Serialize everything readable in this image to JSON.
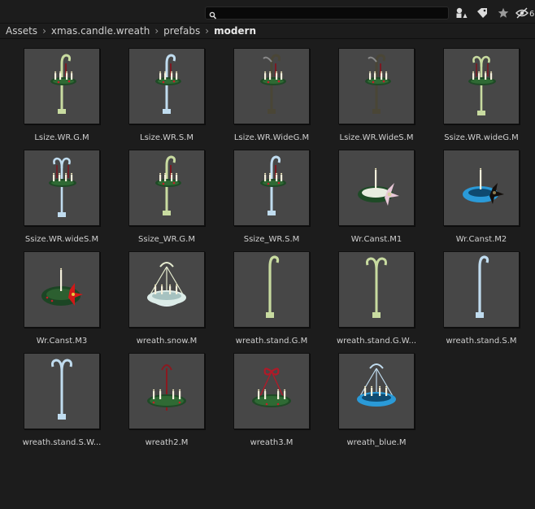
{
  "search": {
    "placeholder": "",
    "value": ""
  },
  "toolbar_icons": [
    "search-icon",
    "filter-type-icon",
    "filter-label-icon",
    "favorites-star-icon",
    "hidden-visibility-icon"
  ],
  "breadcrumb": [
    "Assets",
    "xmas.candle.wreath",
    "prefabs",
    "modern"
  ],
  "assets": [
    {
      "label": "Lsize.WR.G.M",
      "kind": "stand",
      "color": "#c8dba0"
    },
    {
      "label": "Lsize.WR.S.M",
      "kind": "stand",
      "color": "#c0dcef"
    },
    {
      "label": "Lsize.WR.WideG.M",
      "kind": "stand-dark",
      "color": "#3a3a2a"
    },
    {
      "label": "Lsize.WR.WideS.M",
      "kind": "stand-dark",
      "color": "#3a3a4a"
    },
    {
      "label": "Ssize.WR.wideG.M",
      "kind": "stand-double",
      "color": "#c8dba0"
    },
    {
      "label": "Ssize.WR.wideS.M",
      "kind": "stand-double",
      "color": "#c0dcef"
    },
    {
      "label": "Ssize_WR.G.M",
      "kind": "stand",
      "color": "#c8dba0"
    },
    {
      "label": "Ssize_WR.S.M",
      "kind": "stand",
      "color": "#c0dcef"
    },
    {
      "label": "Wr.Canst.M1",
      "kind": "wreath-flower",
      "color": "#e8c8d8"
    },
    {
      "label": "Wr.Canst.M2",
      "kind": "wreath-blue",
      "color": "#2a9ad8"
    },
    {
      "label": "Wr.Canst.M3",
      "kind": "wreath-red",
      "color": "#d01818"
    },
    {
      "label": "wreath.snow.M",
      "kind": "chandelier",
      "color": "#d8ecec"
    },
    {
      "label": "wreath.stand.G.M",
      "kind": "bare-stand",
      "color": "#c8dba0"
    },
    {
      "label": "wreath.stand.G.W...",
      "kind": "bare-double",
      "color": "#c8dba0"
    },
    {
      "label": "wreath.stand.S.M",
      "kind": "bare-stand",
      "color": "#c0dcef"
    },
    {
      "label": "wreath.stand.S.W...",
      "kind": "bare-double",
      "color": "#c0dcef"
    },
    {
      "label": "wreath2.M",
      "kind": "hanging-wreath",
      "color": "#8a1a20"
    },
    {
      "label": "wreath3.M",
      "kind": "bow-wreath",
      "color": "#b01a28"
    },
    {
      "label": "wreath_blue.M",
      "kind": "chandelier-blue",
      "color": "#2a9ad8"
    }
  ]
}
